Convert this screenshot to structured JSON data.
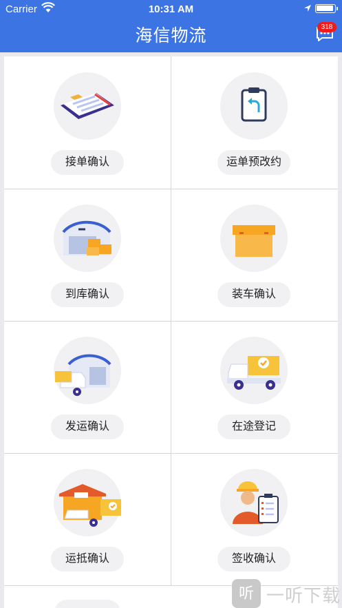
{
  "status_bar": {
    "carrier": "Carrier",
    "time": "10:31 AM"
  },
  "header": {
    "title": "海信物流",
    "message_badge": "318"
  },
  "menu": [
    {
      "label": "接单确认",
      "icon": "clipboard-order-icon"
    },
    {
      "label": "运单预改约",
      "icon": "clipboard-return-icon"
    },
    {
      "label": "到库确认",
      "icon": "warehouse-boxes-icon"
    },
    {
      "label": "装车确认",
      "icon": "cargo-box-icon"
    },
    {
      "label": "发运确认",
      "icon": "truck-depart-icon"
    },
    {
      "label": "在途登记",
      "icon": "truck-in-transit-icon"
    },
    {
      "label": "运抵确认",
      "icon": "truck-arrived-icon"
    },
    {
      "label": "签收确认",
      "icon": "worker-sign-icon"
    }
  ],
  "watermark": {
    "glyph": "听",
    "text": "一听下载"
  },
  "colors": {
    "header": "#3c74e4",
    "badge": "#ee1c1c",
    "accent_orange": "#f6a623",
    "accent_blue": "#3c74e4"
  }
}
